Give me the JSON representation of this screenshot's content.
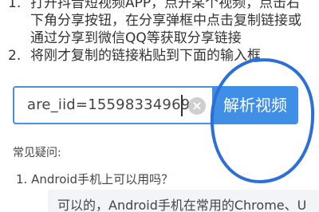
{
  "steps": [
    {
      "number": "1.",
      "lines": [
        "打开抖音短视频APP，点开某个视频，点击右",
        "下角分享按钮，在分享弹框中点击复制链接或",
        "通过分享到微信QQ等获取分享链接"
      ]
    },
    {
      "number": "2.",
      "lines": [
        "将刚才复制的链接粘贴到下面的输入框"
      ]
    }
  ],
  "search": {
    "input_value": "are_iid=15598334969",
    "clear_icon": "close-circle-icon",
    "button_label": "解析视频"
  },
  "faq": {
    "title": "常见疑问:",
    "items": [
      {
        "question": "1. Android手机上可以用吗？",
        "answer": "可以的，Android手机在常用的Chrome、U"
      }
    ]
  },
  "colors": {
    "accent": "#3f8fe6",
    "annotation": "#2c6fd6"
  }
}
